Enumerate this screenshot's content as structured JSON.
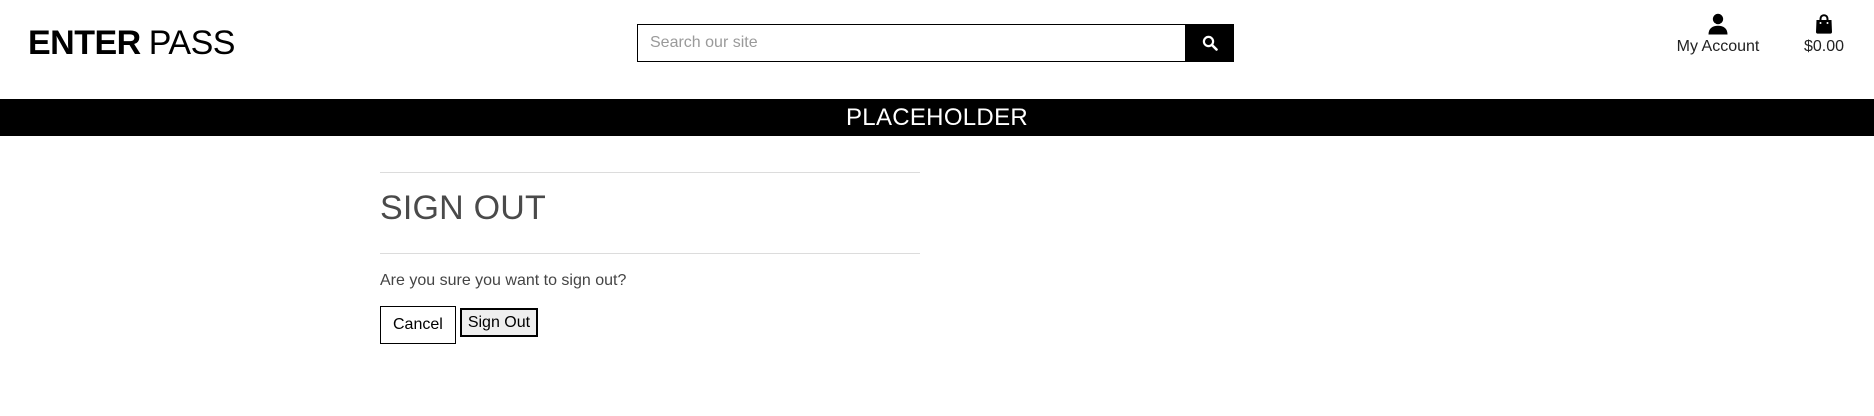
{
  "header": {
    "logo_strong": "ENTER",
    "logo_light": "PASS",
    "search": {
      "placeholder": "Search our site",
      "value": "",
      "button_icon": "search-icon"
    },
    "account": {
      "icon": "user-icon",
      "label": "My Account"
    },
    "cart": {
      "icon": "shopping-bag-icon",
      "total": "$0.00"
    }
  },
  "banner": {
    "text": "PLACEHOLDER"
  },
  "main": {
    "title": "SIGN OUT",
    "prompt": "Are you sure you want to sign out?",
    "cancel_label": "Cancel",
    "signout_label": "Sign Out"
  },
  "colors": {
    "brand": "#000000",
    "banner_bg": "#000000",
    "banner_text": "#ffffff",
    "title_text": "#4a4a4a",
    "rule": "#dcdcdc"
  }
}
